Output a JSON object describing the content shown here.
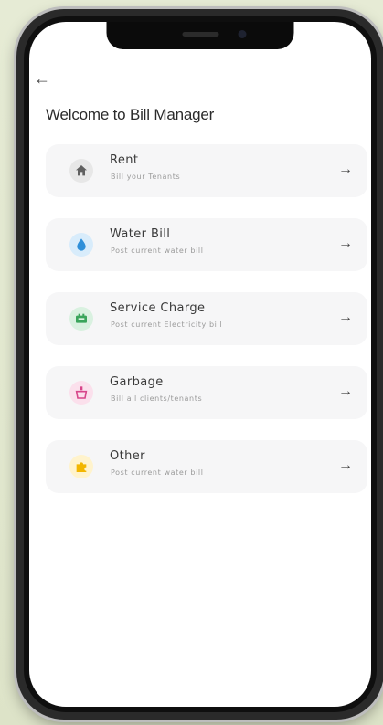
{
  "app": {
    "title": "Welcome to Bill Manager"
  },
  "status_bar": {
    "left": "   ",
    "right": "   "
  },
  "bills": [
    {
      "title": "Rent",
      "subtitle": "Bill your Tenants",
      "icon": "house-icon",
      "icon_color": "#606060",
      "icon_bg": "#e7e7e7"
    },
    {
      "title": "Water Bill",
      "subtitle": "Post current water bill",
      "icon": "water-drop-icon",
      "icon_color": "#2e8fd9",
      "icon_bg": "#d8ecfb"
    },
    {
      "title": "Service Charge",
      "subtitle": "Post current Electricity bill",
      "icon": "electricity-meter-icon",
      "icon_color": "#3aa55b",
      "icon_bg": "#d9f1e0"
    },
    {
      "title": "Garbage",
      "subtitle": "Bill all clients/tenants",
      "icon": "trash-bin-icon",
      "icon_color": "#d7458a",
      "icon_bg": "#fbe0ec"
    },
    {
      "title": "Other",
      "subtitle": "Post current water bill",
      "icon": "puzzle-piece-icon",
      "icon_color": "#f2b600",
      "icon_bg": "#fff3cc"
    }
  ],
  "colors": {
    "background": "#e7ecd8",
    "screen": "#ffffff",
    "card": "#f6f6f7",
    "text_primary": "#3a3a3a",
    "text_secondary": "#9a9a9a"
  }
}
